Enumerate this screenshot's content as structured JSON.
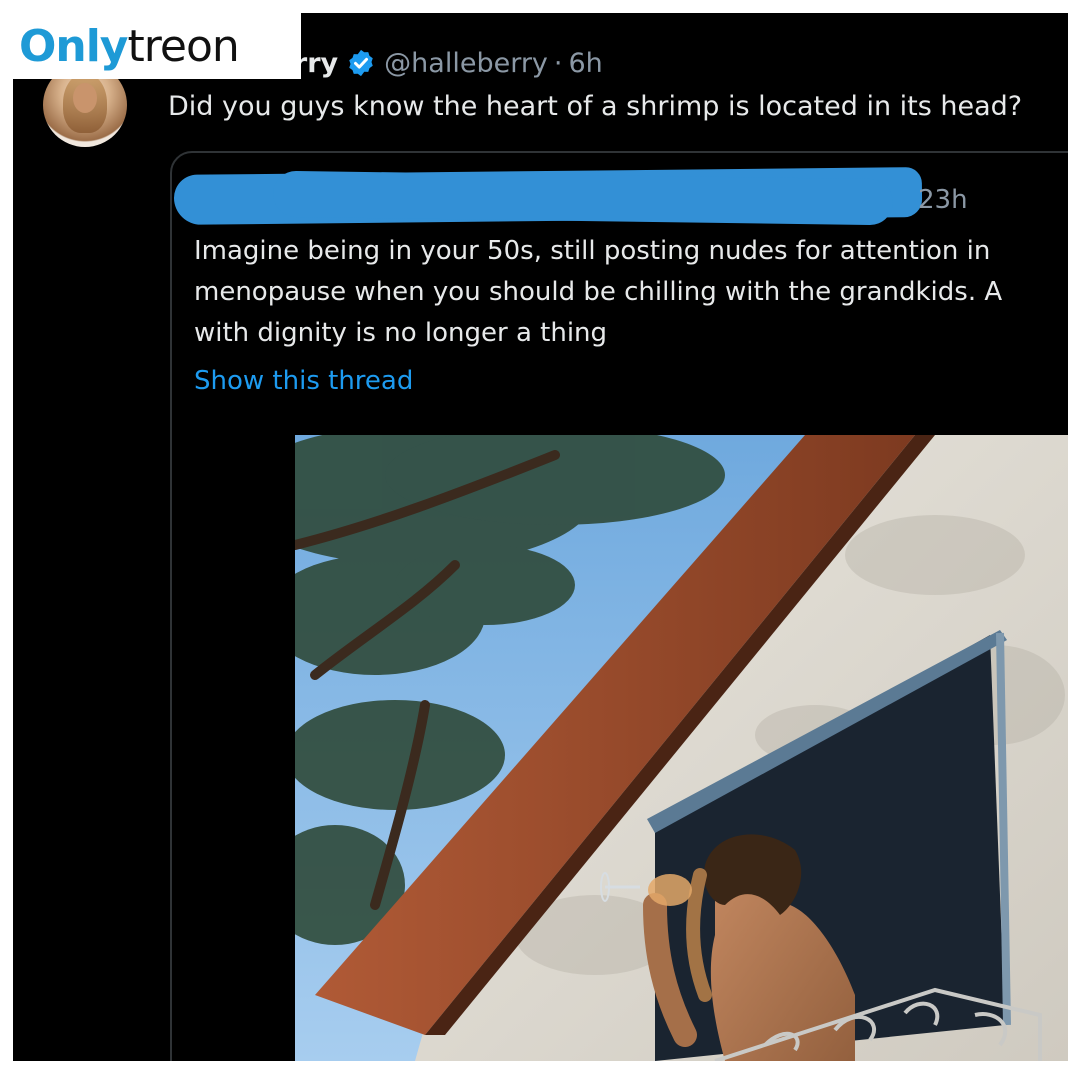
{
  "watermark": {
    "part_a": "Only",
    "part_b": "treon"
  },
  "tweet": {
    "author_name": "Halle Berry",
    "handle": "@halleberry",
    "separator": "·",
    "time": "6h",
    "text": "Did you guys know the heart of a shrimp is located in its head?",
    "verified_icon": "verified-badge-icon",
    "avatar": "profile-avatar"
  },
  "quoted_tweet": {
    "time": "23h",
    "text": "Imagine being in your 50s, still posting nudes for attention in\nmenopause when you should be chilling with the grandkids. A\nwith dignity is no longer a thing",
    "show_thread_label": "Show this thread",
    "redaction_color": "#3390d6",
    "photo": "woman-on-balcony-drinking-wine-photo"
  },
  "colors": {
    "background": "#000000",
    "text_primary": "#e7e9ea",
    "text_secondary": "#8b98a5",
    "link": "#1d9bf0",
    "verified": "#1d9bf0",
    "watermark_accent": "#1e9ad6"
  }
}
